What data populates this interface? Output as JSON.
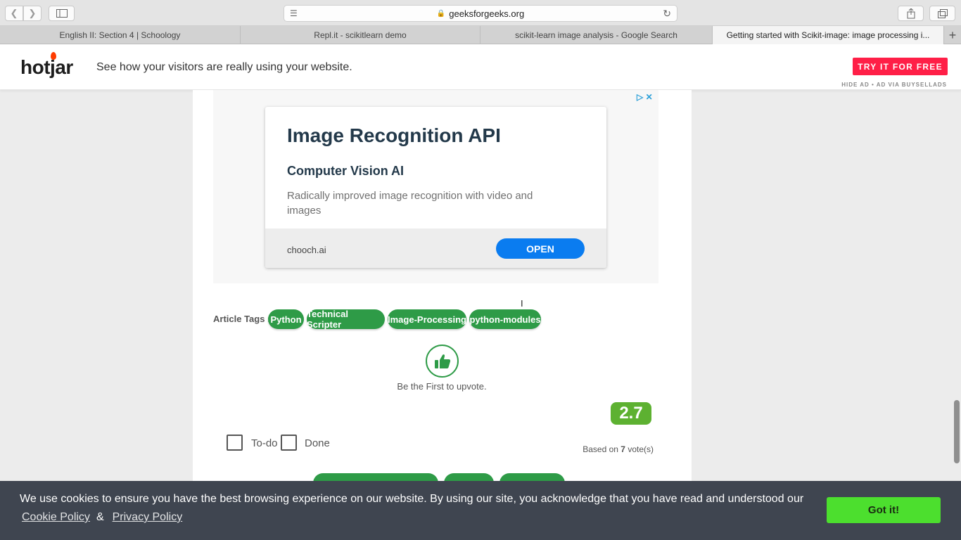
{
  "browser": {
    "url": "geeksforgeeks.org",
    "tabs": [
      {
        "label": "English II: Section 4 | Schoology",
        "width": 342
      },
      {
        "label": "Repl.it - scikitlearn demo",
        "width": 341
      },
      {
        "label": "scikit-learn image analysis - Google Search",
        "width": 330
      },
      {
        "label": "Getting started with Scikit-image: image processing i...",
        "width": 329
      }
    ]
  },
  "hotjar_ad": {
    "logo": "hotjar",
    "tagline": "See how your visitors are really using your website.",
    "cta": "TRY IT FOR FREE",
    "hide_text": "HIDE AD • AD VIA BUYSELLADS"
  },
  "display_ad": {
    "title": "Image Recognition API",
    "subtitle": "Computer Vision AI",
    "description": "Radically improved image recognition with video and images",
    "domain": "chooch.ai",
    "button": "OPEN"
  },
  "article": {
    "tags_label": "Article Tags :",
    "tags": [
      "Python",
      "Technical Scripter",
      "Image-Processing",
      "python-modules"
    ],
    "upvote_text": "Be the First to upvote.",
    "rating": "2.7",
    "votes_prefix": "Based on",
    "votes_count": "7",
    "votes_suffix": "vote(s)",
    "todo_label": "To-do",
    "done_label": "Done"
  },
  "cookie_banner": {
    "text": "We use cookies to ensure you have the best browsing experience on our website. By using our site, you acknowledge that you have read and understood our",
    "cookie_policy": "Cookie Policy",
    "separator": "&",
    "privacy_policy": "Privacy Policy",
    "button": "Got it!"
  },
  "colors": {
    "tag_green": "#2e9b47",
    "rating_green": "#5db131",
    "hotjar_red": "#ff1f47",
    "ad_blue": "#0a7cf0",
    "cookie_bg": "#3f4550",
    "gotit_green": "#4cdf2e"
  }
}
